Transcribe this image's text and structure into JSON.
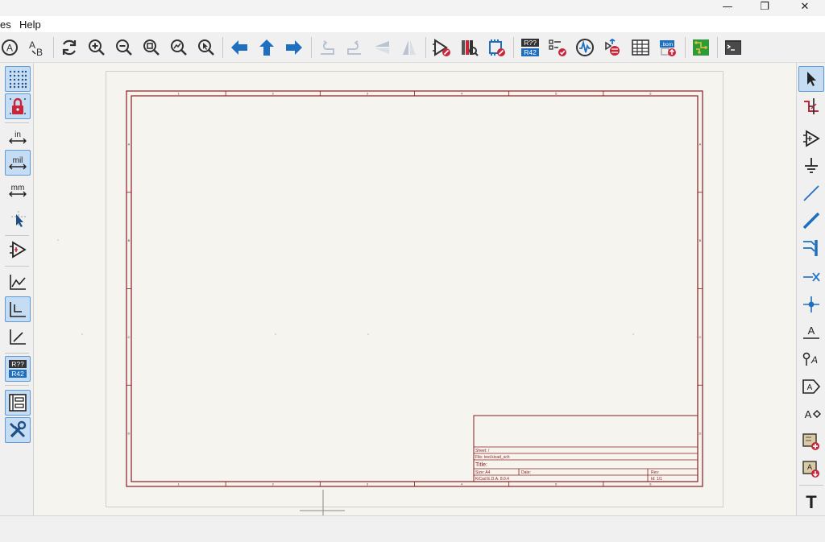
{
  "window": {
    "minimize": "—",
    "restore": "❐",
    "close": "✕"
  },
  "menu": {
    "items": [
      "es",
      "Help"
    ]
  },
  "toolbar": {
    "icons": [
      "annotate-icon",
      "find-replace-icon",
      "refresh-icon",
      "zoom-in-icon",
      "zoom-out-icon",
      "zoom-fit-icon",
      "zoom-objects-icon",
      "zoom-selection-icon",
      "navigate-back-icon",
      "navigate-up-icon",
      "navigate-forward-icon",
      "rotate-ccw-icon",
      "rotate-cw-icon",
      "mirror-vertical-icon",
      "mirror-horizontal-icon",
      "symbol-editor-icon",
      "symbol-browser-icon",
      "footprint-assign-icon",
      "annotate-r42-icon",
      "erc-icon",
      "simulator-icon",
      "netlist-icon",
      "bom-table-icon",
      "bom-generate-icon",
      "pcb-editor-icon",
      "scripting-console-icon"
    ]
  },
  "left_toolbar": {
    "grid_label": "grid",
    "units": {
      "in": "in",
      "mil": "mil",
      "mm": "mm"
    },
    "annotate_top": "R??",
    "annotate_bottom": "R42"
  },
  "annotate_icon": {
    "top": "R??",
    "bottom": "R42"
  },
  "right_toolbar": {
    "label_text": "A",
    "text_tool": "T",
    "netlabel_text": "A"
  },
  "title_block": {
    "sheet": "Sheet: /",
    "file": "File: test.kicad_sch",
    "title": "Title:",
    "size": "Size: A4",
    "date": "Date:",
    "rev": "Rev:",
    "kicad": "KiCad E.D.A. 8.0.4",
    "id": "Id: 1/1"
  },
  "frame": {
    "col_labels": [
      "1",
      "2",
      "3",
      "4",
      "5",
      "6"
    ],
    "row_labels": [
      "A",
      "B",
      "C",
      "D"
    ]
  },
  "colors": {
    "sheet_border": "#8b1c1c",
    "active_button": "#c6dcf2",
    "icon_blue": "#1f6fc1",
    "icon_red": "#c8263a",
    "icon_green": "#2e9a3a",
    "canvas_bg": "#f5f4ef"
  }
}
